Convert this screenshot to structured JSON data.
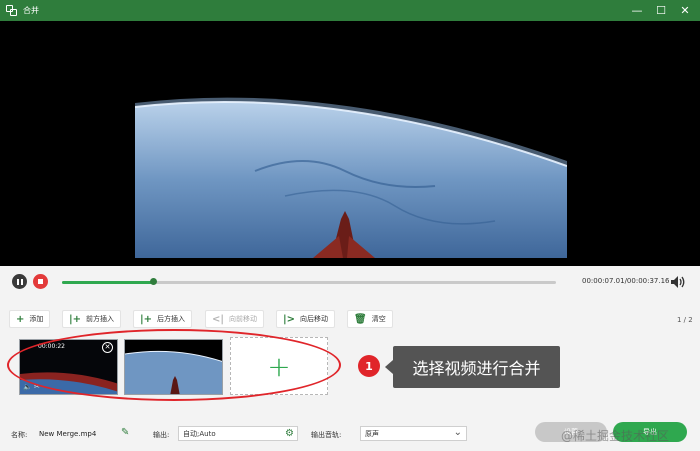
{
  "window": {
    "title": "合并"
  },
  "player": {
    "progress_fraction": 0.185,
    "time_readout": "00:00:07.01/00:00:37.16"
  },
  "toolbar": {
    "add": "添加",
    "insert_before": "前方插入",
    "insert_after": "后方插入",
    "move_forward": "向前移动",
    "move_backward": "向后移动",
    "clear": "清空",
    "page_counter": "1 / 2"
  },
  "clips": [
    {
      "time": "00:00:22"
    },
    {
      "time": ""
    }
  ],
  "annotation": {
    "step_number": "1",
    "callout_text": "选择视频进行合并"
  },
  "bottom": {
    "name_label": "名称:",
    "name_value": "New Merge.mp4",
    "output_label": "输出:",
    "output_value": "自动;Auto",
    "audio_label": "输出音轨:",
    "audio_value": "原声",
    "settings_button": "设置",
    "export_button": "导出",
    "watermark": "@稀土掘金技术社区"
  },
  "colors": {
    "titlebar": "#2f7d3c",
    "accent": "#2fa84f",
    "highlight": "#e0252a"
  }
}
